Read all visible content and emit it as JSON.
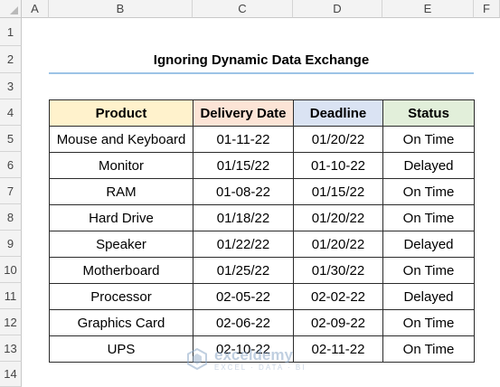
{
  "columns": [
    "A",
    "B",
    "C",
    "D",
    "E",
    "F"
  ],
  "rows": [
    "1",
    "2",
    "3",
    "4",
    "5",
    "6",
    "7",
    "8",
    "9",
    "10",
    "11",
    "12",
    "13",
    "14"
  ],
  "title": "Ignoring Dynamic Data Exchange",
  "table": {
    "headers": [
      "Product",
      "Delivery Date",
      "Deadline",
      "Status"
    ],
    "rows": [
      [
        "Mouse and Keyboard",
        "01-11-22",
        "01/20/22",
        "On Time"
      ],
      [
        "Monitor",
        "01/15/22",
        "01-10-22",
        "Delayed"
      ],
      [
        "RAM",
        "01-08-22",
        "01/15/22",
        "On Time"
      ],
      [
        "Hard Drive",
        "01/18/22",
        "01/20/22",
        "On Time"
      ],
      [
        "Speaker",
        "01/22/22",
        "01/20/22",
        "Delayed"
      ],
      [
        "Motherboard",
        "01/25/22",
        "01/30/22",
        "On Time"
      ],
      [
        "Processor",
        "02-05-22",
        "02-02-22",
        "Delayed"
      ],
      [
        "Graphics Card",
        "02-06-22",
        "02-09-22",
        "On Time"
      ],
      [
        "UPS",
        "02-10-22",
        "02-11-22",
        "On Time"
      ]
    ]
  },
  "header_colors": {
    "product": "#fff2cc",
    "delivery_date": "#fce4d6",
    "deadline": "#dae3f3",
    "status": "#e2efda"
  },
  "title_underline_color": "#9dc3e6",
  "watermark": {
    "name": "exceldemy",
    "tagline": "EXCEL · DATA · BI",
    "icon": "exceldemy-logo-icon"
  }
}
